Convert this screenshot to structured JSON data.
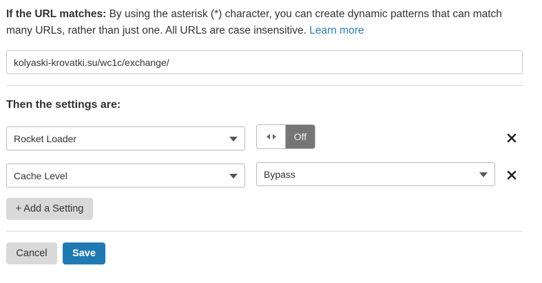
{
  "intro": {
    "lead": "If the URL matches:",
    "text": " By using the asterisk (*) character, you can create dynamic patterns that can match many URLs, rather than just one. All URLs are case insensitive. ",
    "link": "Learn more"
  },
  "url_field": {
    "value": "kolyaski-krovatki.su/wc1c/exchange/"
  },
  "settings": {
    "heading": "Then the settings are:",
    "rows": [
      {
        "setting": "Rocket Loader",
        "value_type": "toggle",
        "value": "Off"
      },
      {
        "setting": "Cache Level",
        "value_type": "select",
        "value": "Bypass"
      }
    ],
    "add_button": "+ Add a Setting"
  },
  "actions": {
    "cancel": "Cancel",
    "save": "Save"
  },
  "icons": {
    "toggle_handle": "arrows-horizontal-icon",
    "remove": "close-icon",
    "dropdown": "chevron-down-icon"
  },
  "colors": {
    "link": "#2c7cb0",
    "primary": "#1f7ab4",
    "toggle_off": "#757575",
    "secondary_button": "#d9d9d9"
  }
}
